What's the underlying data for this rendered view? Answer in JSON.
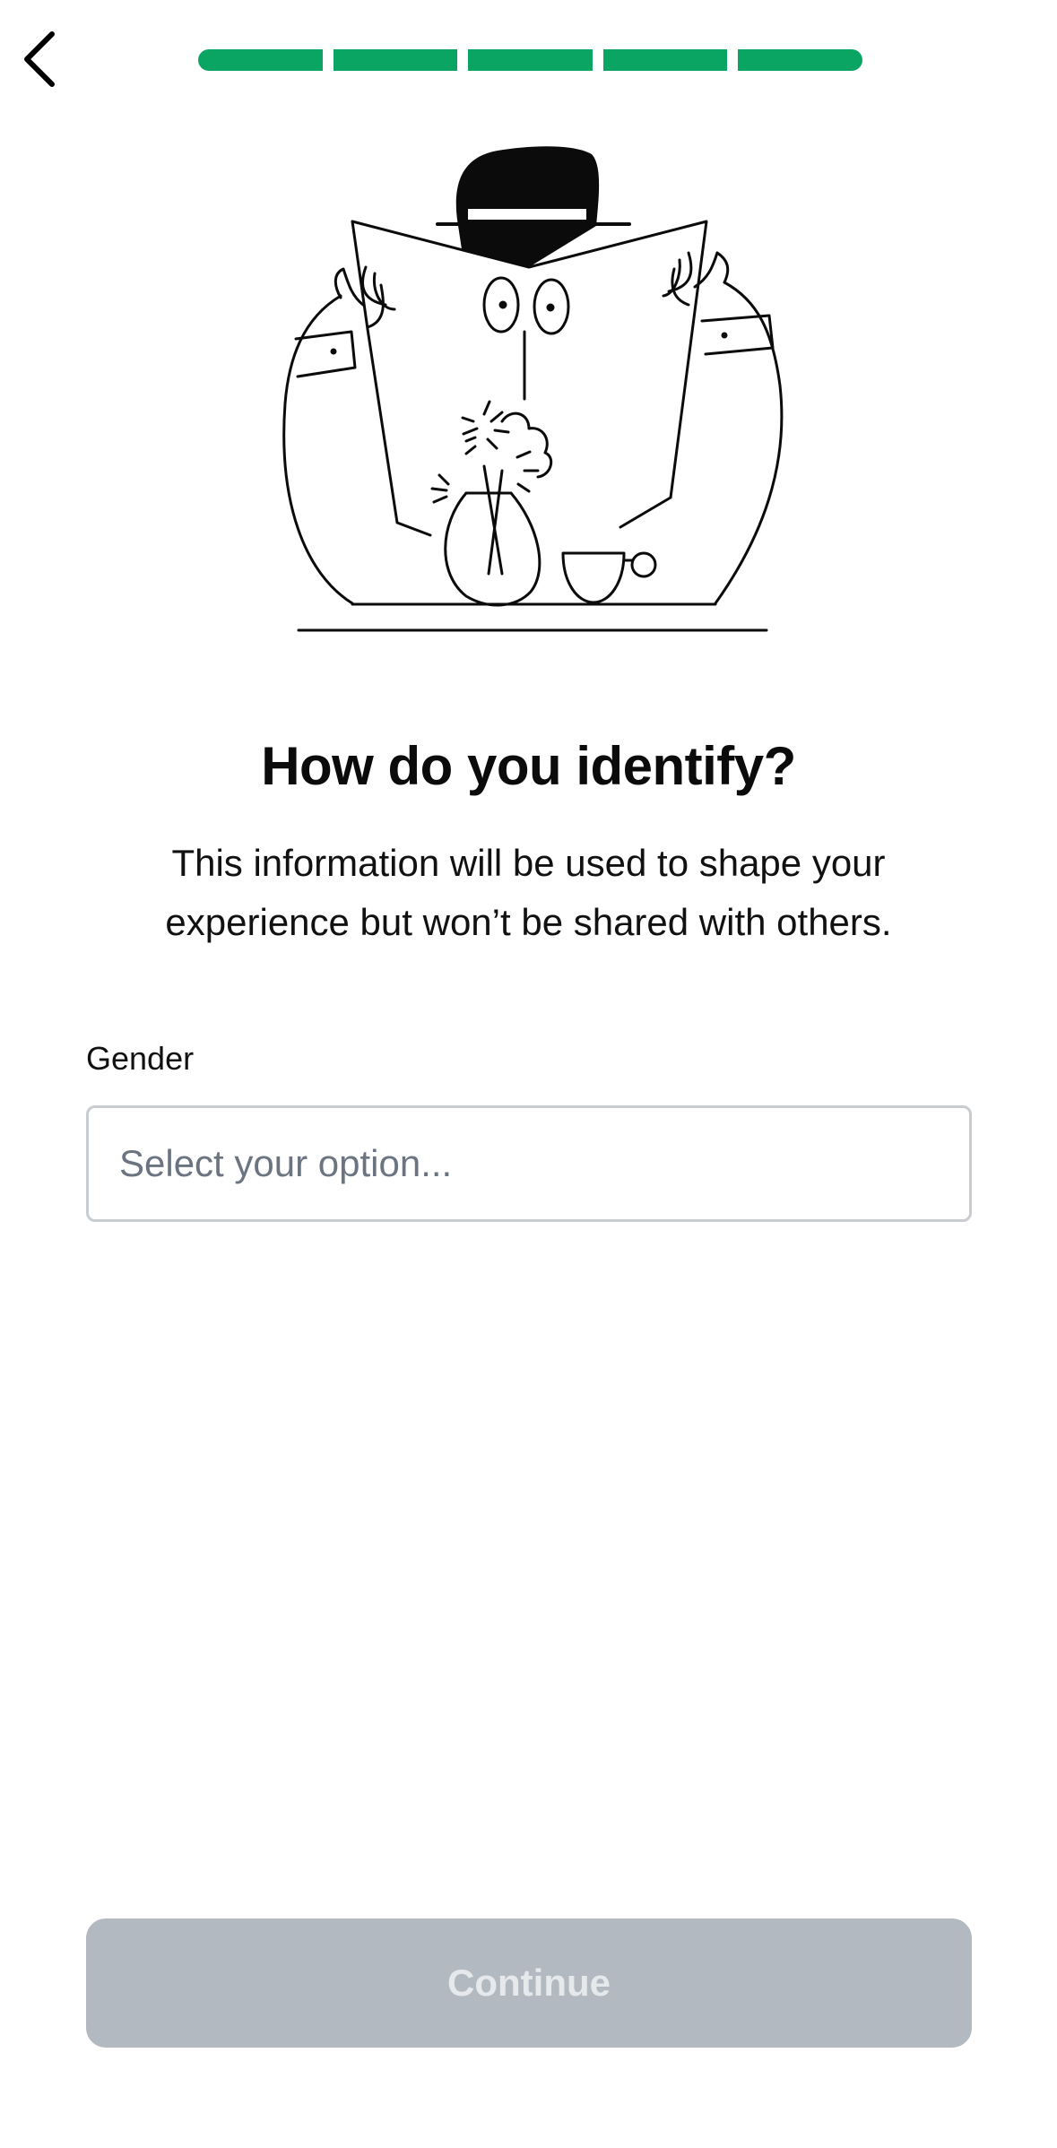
{
  "nav": {
    "back_icon": "chevron-left-icon"
  },
  "progress": {
    "total_steps": 5,
    "completed_steps": 5,
    "accent_color": "#0aa463"
  },
  "illustration": {
    "icon": "person-reading-newspaper-illustration"
  },
  "heading": {
    "title": "How do you identify?",
    "subtitle": "This information will be used to shape your experience but won’t be shared with others."
  },
  "form": {
    "gender_label": "Gender",
    "gender_placeholder": "Select your option...",
    "gender_value": ""
  },
  "footer": {
    "continue_label": "Continue",
    "continue_enabled": false
  }
}
